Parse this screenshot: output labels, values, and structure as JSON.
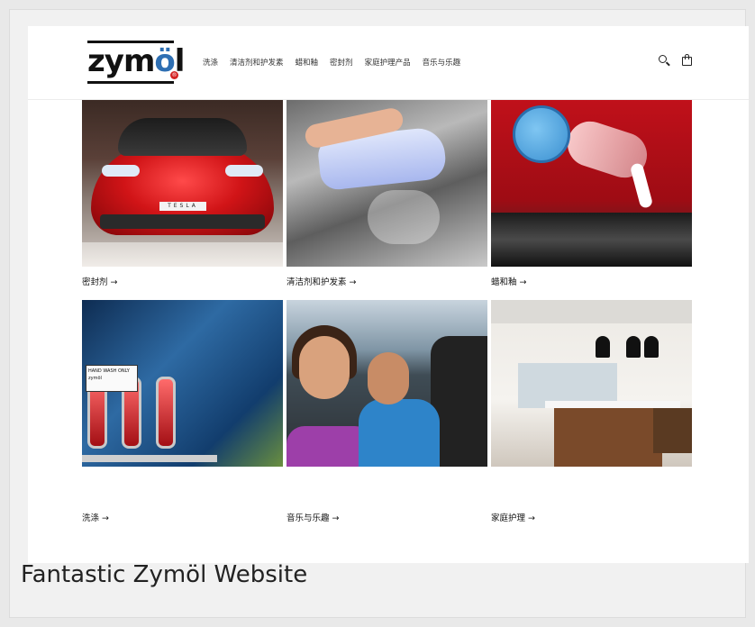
{
  "header": {
    "logo_text_pre": "zym",
    "logo_text_o": "ö",
    "logo_text_post": "l",
    "logo_reg": "®",
    "nav": [
      "洗涤",
      "清洁剂和护发素",
      "蜡和釉",
      "密封剂",
      "家庭护理产品",
      "音乐与乐趣"
    ],
    "search_icon": "search-icon",
    "cart_icon": "cart-icon"
  },
  "collections": [
    {
      "label": "密封剂 →",
      "image": "red-tesla-car"
    },
    {
      "label": "清洁剂和护发素 →",
      "image": "hand-cleaning-car-with-cloth"
    },
    {
      "label": "蜡和釉 →",
      "image": "wax-pad-on-red-car"
    },
    {
      "label": "洗涤 →",
      "image": "mustang-taillights-with-sticker"
    },
    {
      "label": "音乐与乐趣 →",
      "image": "couple-in-convertible"
    },
    {
      "label": "家庭护理 →",
      "image": "modern-kitchen"
    }
  ],
  "image_text": {
    "plate": "TESLA",
    "sticker_line1": "HAND WASH ONLY",
    "sticker_line2": "zymöl"
  },
  "caption": "Fantastic Zymöl Website",
  "colors": {
    "page_bg": "#e9e9e9",
    "site_bg": "#ffffff",
    "text": "#121212",
    "logo_accent": "#2e6fb3"
  }
}
